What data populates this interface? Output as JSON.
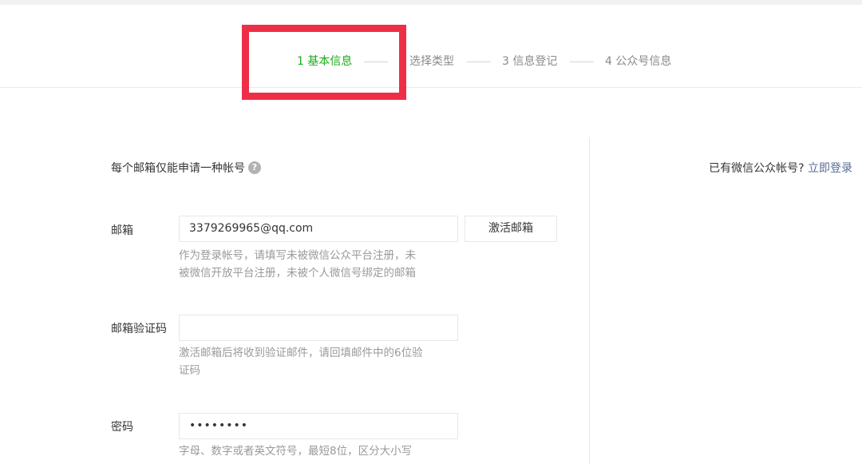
{
  "steps": [
    {
      "label": "1 基本信息",
      "active": true
    },
    {
      "label": "选择类型",
      "active": false
    },
    {
      "label": "3 信息登记",
      "active": false
    },
    {
      "label": "4 公众号信息",
      "active": false
    }
  ],
  "notice": "每个邮箱仅能申请一种帐号",
  "login_hint": {
    "text": "已有微信公众帐号?",
    "link": "立即登录"
  },
  "form": {
    "email": {
      "label": "邮箱",
      "value": "3379269965@qq.com",
      "button": "激活邮箱",
      "tip_line1": "作为登录帐号，请填写未被微信公众平台注册，未",
      "tip_line2": "被微信开放平台注册，未被个人微信号绑定的邮箱"
    },
    "code": {
      "label": "邮箱验证码",
      "value": "",
      "tip_line1": "激活邮箱后将收到验证邮件，请回填邮件中的6位验",
      "tip_line2": "证码"
    },
    "password": {
      "label": "密码",
      "value": "••••••••",
      "tip_line1": "字母、数字或者英文符号，最短8位，区分大小写"
    }
  },
  "colors": {
    "active_step": "#1aad19",
    "highlight": "#ee2e47",
    "link": "#576b95"
  }
}
